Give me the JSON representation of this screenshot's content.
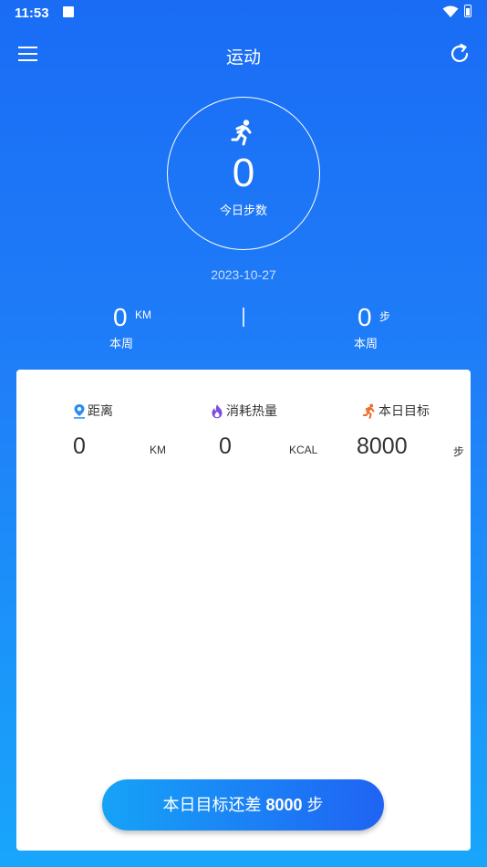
{
  "status": {
    "time": "11:53"
  },
  "header": {
    "title": "运动"
  },
  "today": {
    "steps": "0",
    "steps_label": "今日步数",
    "date": "2023-10-27"
  },
  "week": {
    "distance_value": "0",
    "distance_unit": "KM",
    "distance_label": "本周",
    "steps_value": "0",
    "steps_unit": "步",
    "steps_label": "本周"
  },
  "stats": {
    "distance": {
      "label": "距离",
      "value": "0",
      "unit": "KM"
    },
    "calories": {
      "label": "消耗热量",
      "value": "0",
      "unit": "KCAL"
    },
    "goal": {
      "label": "本日目标",
      "value": "8000",
      "unit": "步"
    }
  },
  "goal_button": {
    "prefix": "本日目标还差",
    "remaining": "8000",
    "suffix": "步"
  },
  "colors": {
    "accent": "#1f7ff8",
    "distance_icon": "#2a8cf0",
    "fire_icon": "#7b4ce0",
    "runner_icon": "#f06a2a"
  },
  "icons": [
    "menu-icon",
    "refresh-icon",
    "runner-icon",
    "location-pin-icon",
    "fire-icon",
    "wifi-icon",
    "battery-icon"
  ]
}
